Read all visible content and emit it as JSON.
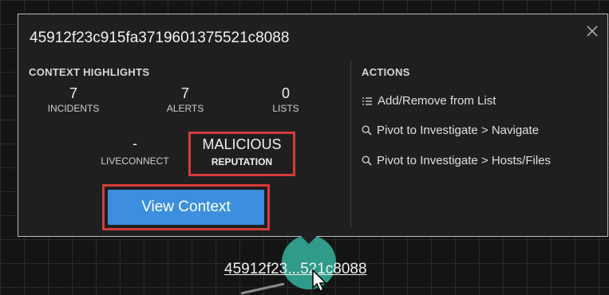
{
  "popup": {
    "title": "45912f23c915fa3719601375521c8088",
    "context_title": "CONTEXT HIGHLIGHTS",
    "actions_title": "ACTIONS",
    "stats": [
      {
        "value": "7",
        "label": "INCIDENTS"
      },
      {
        "value": "7",
        "label": "ALERTS"
      },
      {
        "value": "0",
        "label": "LISTS"
      }
    ],
    "liveconnect": {
      "value": "-",
      "label": "LIVECONNECT"
    },
    "reputation": {
      "value": "MALICIOUS",
      "label": "REPUTATION"
    },
    "view_button": "View Context",
    "actions": [
      {
        "icon": "list-icon",
        "label": "Add/Remove from List"
      },
      {
        "icon": "search-icon",
        "label": "Pivot to Investigate > Navigate"
      },
      {
        "icon": "search-icon",
        "label": "Pivot to Investigate > Hosts/Files"
      }
    ]
  },
  "node": {
    "label": "45912f23...521c8088"
  },
  "colors": {
    "highlight_box": "#d63b3b",
    "button": "#3c8fde",
    "node": "#2f9b88"
  }
}
